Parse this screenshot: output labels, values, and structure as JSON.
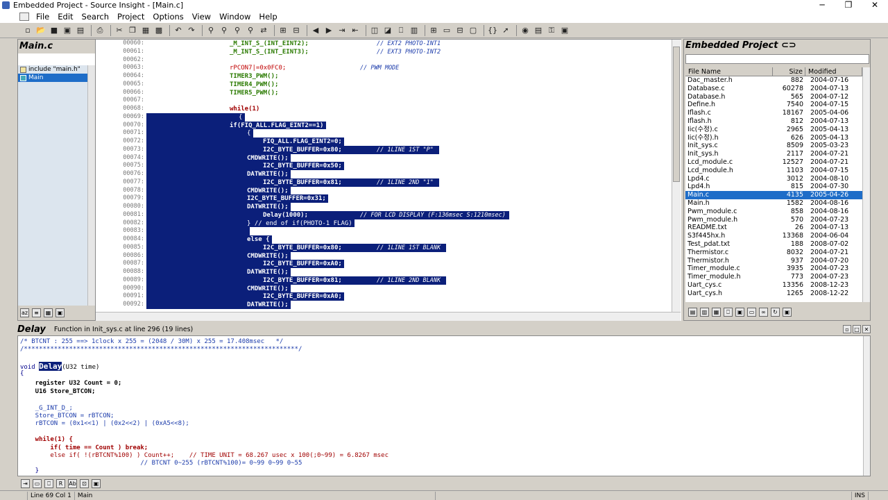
{
  "window": {
    "title": "Embedded Project - Source Insight - [Main.c]",
    "minimize": "─",
    "restore": "❐",
    "close": "✕"
  },
  "menu": [
    "File",
    "Edit",
    "Search",
    "Project",
    "Options",
    "View",
    "Window",
    "Help"
  ],
  "symbol_window": {
    "title": "Main.c",
    "items": [
      {
        "label": "include \"main.h\""
      },
      {
        "label": "Main"
      }
    ]
  },
  "editor": {
    "lines": [
      {
        "n": "00060:",
        "code": "_M_INT_S_(INT_EINT2);",
        "comment": "// EXT2 PHOTO-INT1"
      },
      {
        "n": "00061:",
        "code": "_M_INT_S_(INT_EINT3);",
        "comment": "// EXT3 PHOTO-INT2"
      },
      {
        "n": "00062:",
        "code": ""
      },
      {
        "n": "00063:",
        "code": "rPCON7|=0x0FC0;",
        "comment": "// PWM MODE"
      },
      {
        "n": "00064:",
        "code": "TIMER3_PWM();"
      },
      {
        "n": "00065:",
        "code": "TIMER4_PWM();"
      },
      {
        "n": "00066:",
        "code": "TIMER5_PWM();"
      },
      {
        "n": "00067:",
        "code": ""
      },
      {
        "n": "00068:",
        "code": "while(1)"
      },
      {
        "n": "00069:",
        "code": "{"
      },
      {
        "n": "00070:",
        "code": "if(FIQ_ALL.FLAG_EINT2==1)"
      },
      {
        "n": "00071:",
        "code": "{"
      },
      {
        "n": "00072:",
        "code": "FIQ_ALL.FLAG_EINT2=0;"
      },
      {
        "n": "00073:",
        "code": "I2C_BYTE_BUFFER=0x80;",
        "comment": "// 1LINE 1ST \"P\""
      },
      {
        "n": "00074:",
        "code": "CMDWRITE();"
      },
      {
        "n": "00075:",
        "code": "I2C_BYTE_BUFFER=0x50;"
      },
      {
        "n": "00076:",
        "code": "DATWRITE();"
      },
      {
        "n": "00077:",
        "code": "I2C_BYTE_BUFFER=0x81;",
        "comment": "// 1LINE 2ND \"1\""
      },
      {
        "n": "00078:",
        "code": "CMDWRITE();"
      },
      {
        "n": "00079:",
        "code": "I2C_BYTE_BUFFER=0x31;"
      },
      {
        "n": "00080:",
        "code": "DATWRITE();"
      },
      {
        "n": "00081:",
        "code": "Delay(1000);",
        "comment": "// FOR LCD DISPLAY (F:136msec S:1210msec)"
      },
      {
        "n": "00082:",
        "code": "} // end of if(PHOTO-1 FLAG)"
      },
      {
        "n": "00083:",
        "code": ""
      },
      {
        "n": "00084:",
        "code": "else {"
      },
      {
        "n": "00085:",
        "code": "I2C_BYTE_BUFFER=0x80;",
        "comment": "// 1LINE 1ST BLANK"
      },
      {
        "n": "00086:",
        "code": "CMDWRITE();"
      },
      {
        "n": "00087:",
        "code": "I2C_BYTE_BUFFER=0xA0;"
      },
      {
        "n": "00088:",
        "code": "DATWRITE();"
      },
      {
        "n": "00089:",
        "code": "I2C_BYTE_BUFFER=0x81;",
        "comment": "// 1LINE 2ND BLANK"
      },
      {
        "n": "00090:",
        "code": "CMDWRITE();"
      },
      {
        "n": "00091:",
        "code": "I2C_BYTE_BUFFER=0xA0;"
      },
      {
        "n": "00092:",
        "code": "DATWRITE();"
      }
    ]
  },
  "project": {
    "title": "Embedded Project",
    "columns": {
      "name": "File Name",
      "size": "Size",
      "modified": "Modified"
    },
    "files": [
      {
        "name": "Dac_master.h",
        "size": "882",
        "date": "2004-07-16"
      },
      {
        "name": "Database.c",
        "size": "60278",
        "date": "2004-07-13"
      },
      {
        "name": "Database.h",
        "size": "565",
        "date": "2004-07-12"
      },
      {
        "name": "Define.h",
        "size": "7540",
        "date": "2004-07-15"
      },
      {
        "name": "Iflash.c",
        "size": "18167",
        "date": "2005-04-06"
      },
      {
        "name": "Iflash.h",
        "size": "812",
        "date": "2004-07-13"
      },
      {
        "name": "Iic(수정).c",
        "size": "2965",
        "date": "2005-04-13"
      },
      {
        "name": "Iic(수정).h",
        "size": "626",
        "date": "2005-04-13"
      },
      {
        "name": "Init_sys.c",
        "size": "8509",
        "date": "2005-03-23"
      },
      {
        "name": "Init_sys.h",
        "size": "2117",
        "date": "2004-07-21"
      },
      {
        "name": "Lcd_module.c",
        "size": "12527",
        "date": "2004-07-21"
      },
      {
        "name": "Lcd_module.h",
        "size": "1103",
        "date": "2004-07-15"
      },
      {
        "name": "Lpd4.c",
        "size": "3012",
        "date": "2004-08-10"
      },
      {
        "name": "Lpd4.h",
        "size": "815",
        "date": "2004-07-30"
      },
      {
        "name": "Main.c",
        "size": "4135",
        "date": "2005-04-26"
      },
      {
        "name": "Main.h",
        "size": "1582",
        "date": "2004-08-16"
      },
      {
        "name": "Pwm_module.c",
        "size": "858",
        "date": "2004-08-16"
      },
      {
        "name": "Pwm_module.h",
        "size": "570",
        "date": "2004-07-23"
      },
      {
        "name": "README.txt",
        "size": "26",
        "date": "2004-07-13"
      },
      {
        "name": "S3f445hx.h",
        "size": "13368",
        "date": "2004-06-04"
      },
      {
        "name": "Test_pdat.txt",
        "size": "188",
        "date": "2008-07-02"
      },
      {
        "name": "Thermistor.c",
        "size": "8032",
        "date": "2004-07-21"
      },
      {
        "name": "Thermistor.h",
        "size": "937",
        "date": "2004-07-20"
      },
      {
        "name": "Timer_module.c",
        "size": "3935",
        "date": "2004-07-23"
      },
      {
        "name": "Timer_module.h",
        "size": "773",
        "date": "2004-07-23"
      },
      {
        "name": "Uart_cys.c",
        "size": "13356",
        "date": "2008-12-23"
      },
      {
        "name": "Uart_cys.h",
        "size": "1265",
        "date": "2008-12-22"
      }
    ]
  },
  "context": {
    "title": "Delay",
    "info": "Function in Init_sys.c at line 296 (19 lines)",
    "lines": [
      "/* BTCNT : 255 ==> 1clock x 255 = (2048 / 30M) x 255 = 17.408msec   */",
      "/*************************************************************************/",
      "",
      "void Delay(U32 time)",
      "{",
      "    register U32 Count = 0;",
      "    U16 Store_BTCON;",
      "",
      "    _G_INT_D_;",
      "    Store_BTCON = rBTCON;",
      "    rBTCON = (0x1<<1) | (0x2<<2) | (0xA5<<8);",
      "",
      "    while(1) {",
      "        if( time == Count ) break;",
      "        else if( !(rBTCNT%100) ) Count++;    // TIME UNIT = 68.267 usec x 100(;0~99) = 6.8267 msec",
      "                                // BTCNT 0~255 (rBTCNT%100)= 0~99 0~99 0~55",
      "    }"
    ]
  },
  "status": {
    "pos": "Line 69  Col 1",
    "func": "Main",
    "mode": "INS"
  }
}
